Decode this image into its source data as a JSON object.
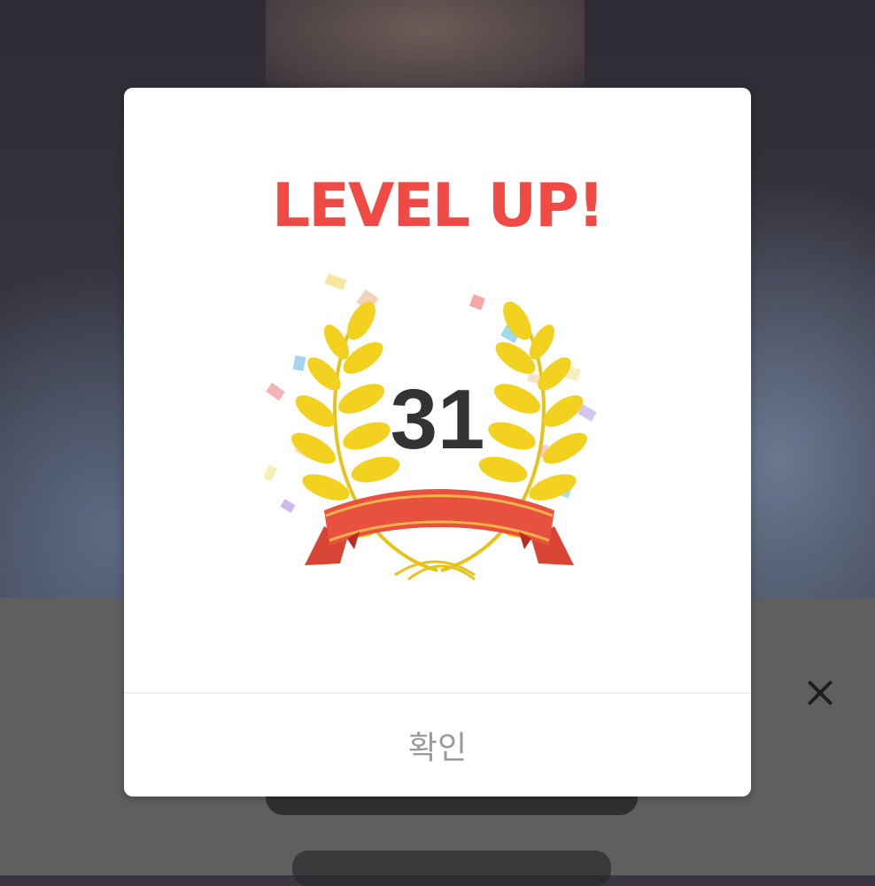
{
  "modal": {
    "title": "LEVEL UP!",
    "level": "31",
    "confirm_label": "확인"
  },
  "icons": {
    "close": "close-icon",
    "wreath": "laurel-wreath-icon"
  },
  "colors": {
    "title": "#f04a45",
    "level": "#333333",
    "wreath": "#f0cc1e",
    "ribbon": "#e8503f",
    "confirm": "#9a9a9a"
  }
}
